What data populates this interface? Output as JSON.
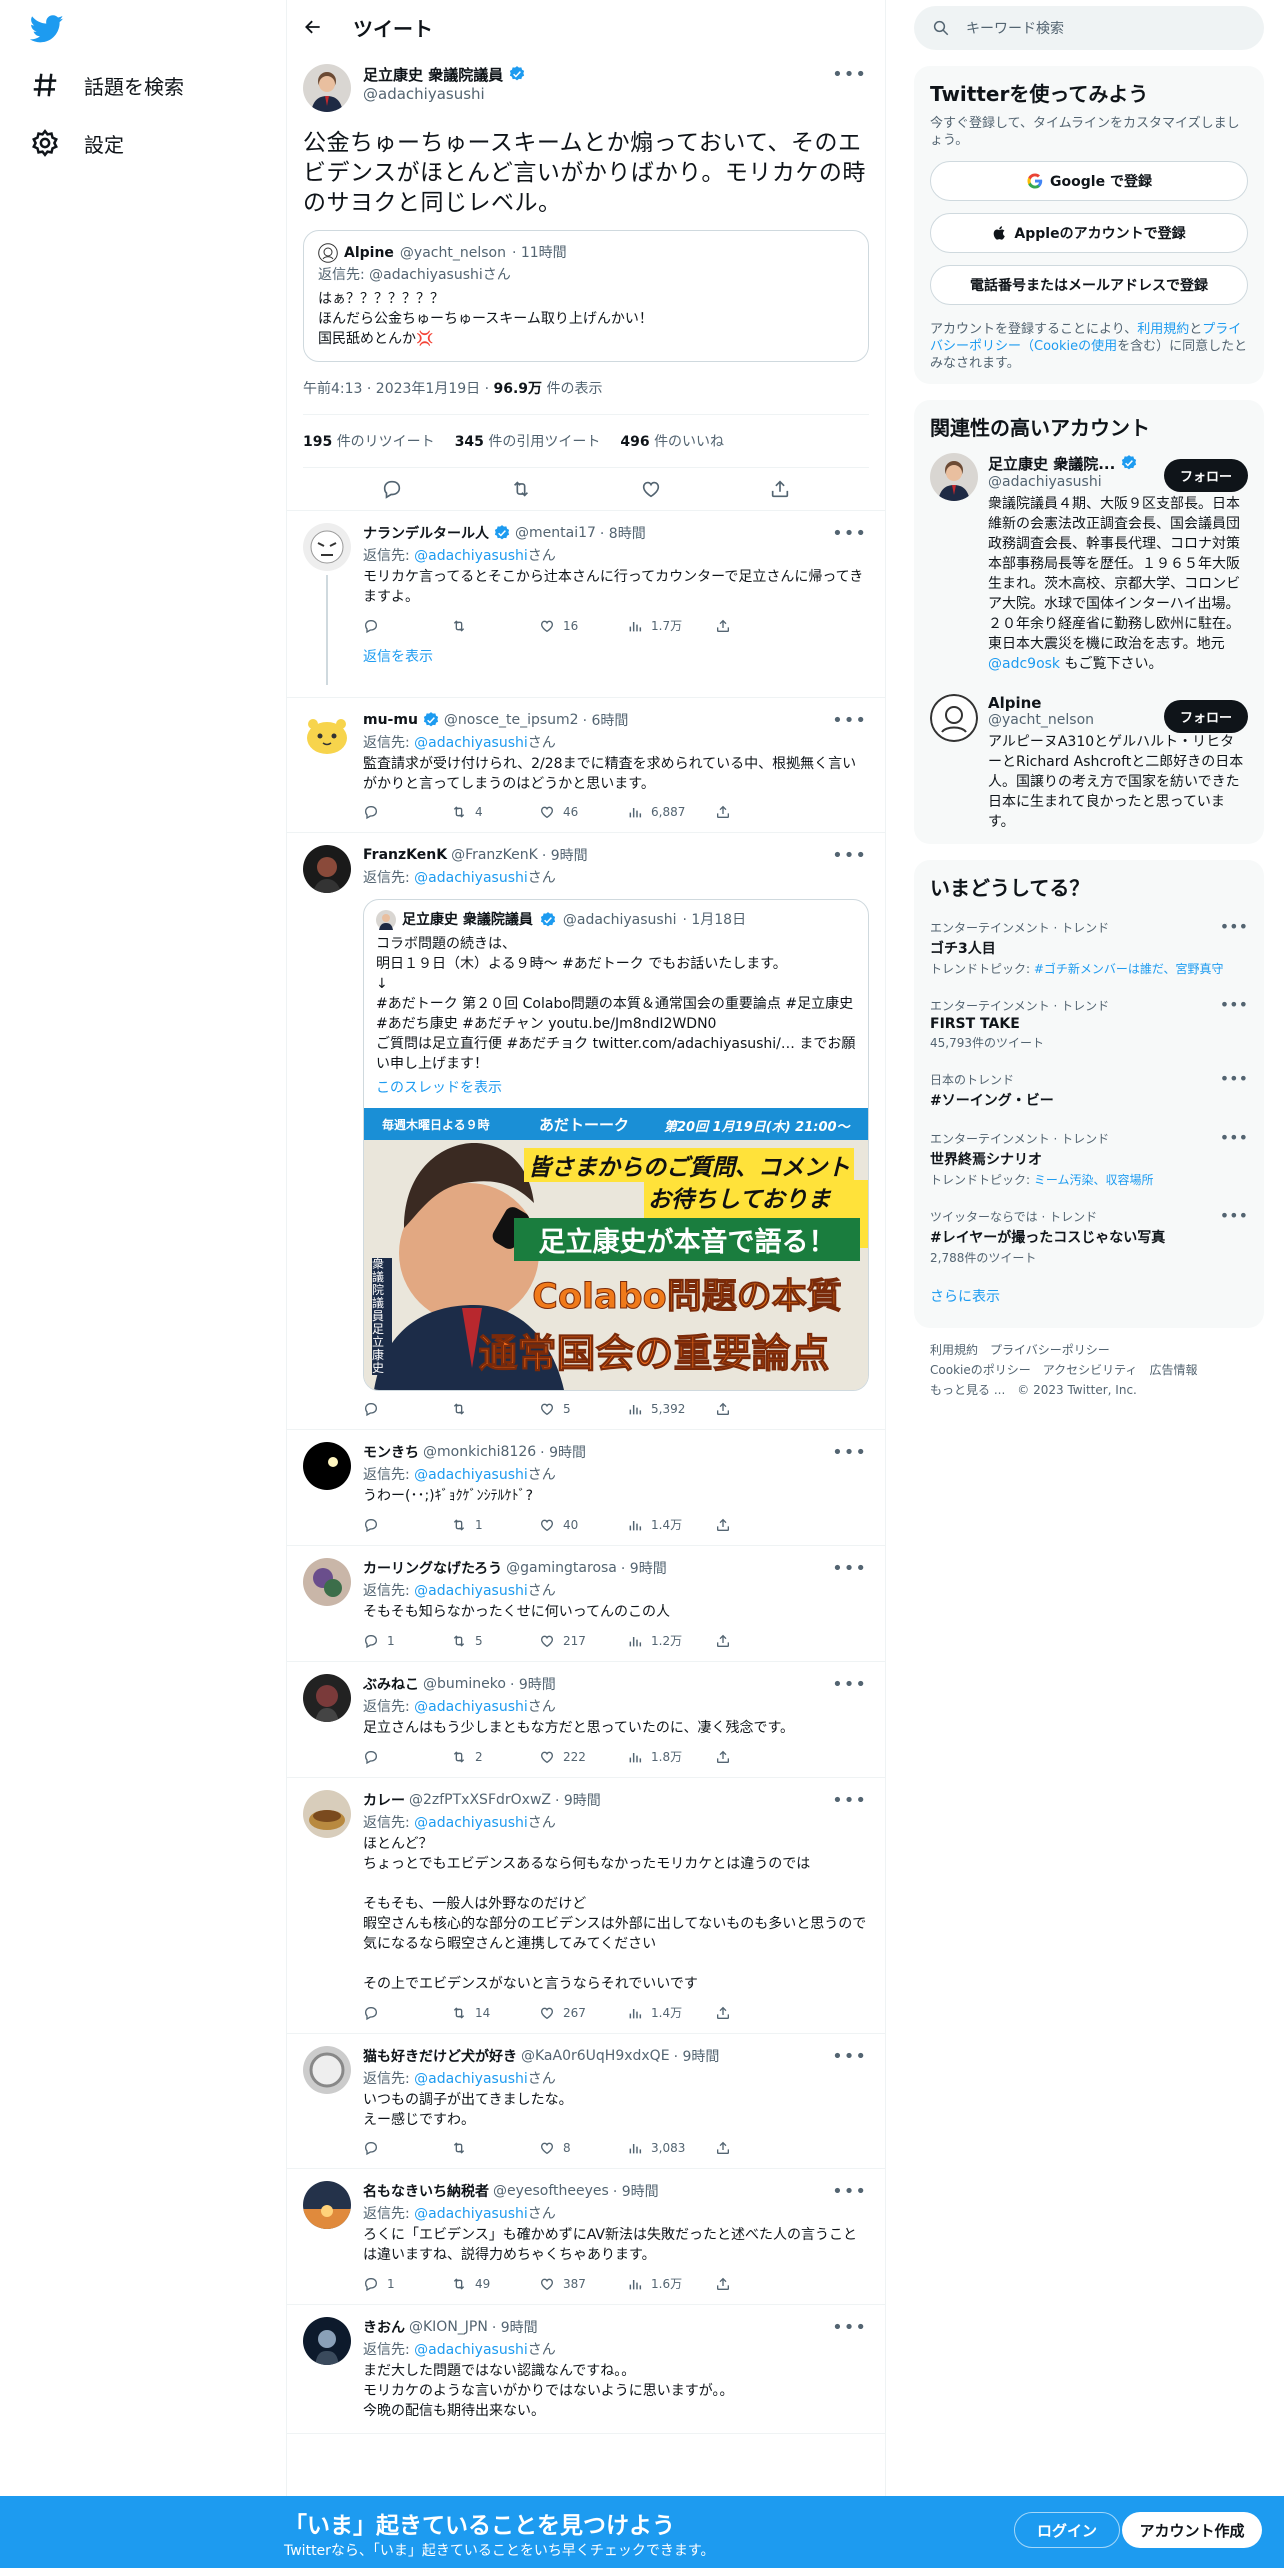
{
  "colors": {
    "accent": "#1d9bf0",
    "text": "#0f1419",
    "muted": "#536471"
  },
  "nav": {
    "explore": "話題を検索",
    "settings": "設定"
  },
  "header": {
    "title": "ツイート"
  },
  "tweet": {
    "name": "足立康史 衆議院議員",
    "handle": "@adachiyasushi",
    "text": "公金ちゅーちゅースキームとか煽っておいて、そのエビデンスがほとんど言いがかりばかり。モリカケの時のサヨクと同じレベル。",
    "quote": {
      "name": "Alpine",
      "handle": "@yacht_nelson",
      "time": "· 11時間",
      "replyto": "返信先: @adachiyasushiさん",
      "text": "はぁ？？？？？？？\nほんだら公金ちゅーちゅースキーム取り上げんかい！\n国民舐めとんか💢"
    },
    "time": "午前4:13 · 2023年1月19日 · ",
    "views_num": "96.9万",
    "views_label": " 件の表示",
    "retweets": "195",
    "retweets_label": "件のリツイート",
    "quotes": "345",
    "quotes_label": "件の引用ツイート",
    "likes": "496",
    "likes_label": "件のいいね"
  },
  "replies": [
    {
      "name": "ナランデルタール人",
      "handle": "@mentai17",
      "time": "· 8時間",
      "replyto_prefix": "返信先: ",
      "replyto_link": "@adachiyasushi",
      "replyto_suffix": "さん",
      "text": "モリカケ言ってるとそこから辻本さんに行ってカウンターで足立さんに帰ってきますよ。",
      "rt": "",
      "likes": "16",
      "views": "1.7万",
      "showmore": "返信を表示"
    },
    {
      "name": "mu-mu",
      "handle": "@nosce_te_ipsum2",
      "time": "· 6時間",
      "replyto_prefix": "返信先: ",
      "replyto_link": "@adachiyasushi",
      "replyto_suffix": "さん",
      "text": "監査請求が受け付けられ、2/28までに精査を求められている中、根拠無く言いがかりと言ってしまうのはどうかと思います。",
      "rt": "4",
      "likes": "46",
      "views": "6,887"
    },
    {
      "name": "FranzKenK",
      "handle": "@FranzKenK",
      "time": "· 9時間",
      "replyto_prefix": "返信先: ",
      "replyto_link": "@adachiyasushi",
      "replyto_suffix": "さん",
      "text": "",
      "rt": "",
      "likes": "5",
      "views": "5,392",
      "embed": {
        "name": "足立康史 衆議院議員",
        "handle": "@adachiyasushi",
        "time": "· 1月18日",
        "text": "コラボ問題の続きは、\n明日１９日（木）よる９時〜 #あだトーク でもお話いたします。\n↓\n#あだトーク 第２０回 Colabo問題の本質＆通常国会の重要論点 #足立康史 #あだち康史 #あだチャン youtu.be/Jm8ndI2WDN0\nご質問は足立直行便 #あだチョク twitter.com/adachiyasushi/… までお願い申し上げます！",
        "thread": "このスレッドを表示",
        "banner": {
          "tag": "毎週木曜日よる９時",
          "show": "あだトーーク",
          "ep": "第20回 1月19日(木) 21:00〜",
          "l1": "皆さまからのご質問、コメント",
          "l2": "お待ちしております！",
          "l3": "足立康史が本音で語る！",
          "l4": "Colabo問題の本質",
          "l5": "通常国会の重要論点",
          "vert": "衆議院議員 足立康史"
        }
      }
    },
    {
      "name": "モンきち",
      "handle": "@monkichi8126",
      "time": "· 9時間",
      "replyto_prefix": "返信先: ",
      "replyto_link": "@adachiyasushi",
      "replyto_suffix": "さん",
      "text": "うわー(･･;)ｷﾞｮｸｹﾞﾝｼﾃﾙｹﾄﾞ?",
      "rt": "1",
      "likes": "40",
      "views": "1.4万"
    },
    {
      "name": "カーリングなげたろう",
      "handle": "@gamingtarosa",
      "time": "· 9時間",
      "replyto_prefix": "返信先: ",
      "replyto_link": "@adachiyasushi",
      "replyto_suffix": "さん",
      "text": "そもそも知らなかったくせに何いってんのこの人",
      "reply": "1",
      "rt": "5",
      "likes": "217",
      "views": "1.2万"
    },
    {
      "name": "ぶみねこ",
      "handle": "@bumineko",
      "time": "· 9時間",
      "replyto_prefix": "返信先: ",
      "replyto_link": "@adachiyasushi",
      "replyto_suffix": "さん",
      "text": "足立さんはもう少しまともな方だと思っていたのに、凄く残念です。",
      "rt": "2",
      "likes": "222",
      "views": "1.8万"
    },
    {
      "name": "カレー",
      "handle": "@2zfPTxXSFdrOxwZ",
      "time": "· 9時間",
      "replyto_prefix": "返信先: ",
      "replyto_link": "@adachiyasushi",
      "replyto_suffix": "さん",
      "text": "ほとんど？\nちょっとでもエビデンスあるなら何もなかったモリカケとは違うのでは\n\nそもそも、一般人は外野なのだけど\n暇空さんも核心的な部分のエビデンスは外部に出してないものも多いと思うので\n気になるなら暇空さんと連携してみてください\n\nその上でエビデンスがないと言うならそれでいいです",
      "rt": "14",
      "likes": "267",
      "views": "1.4万"
    },
    {
      "name": "猫も好きだけど犬が好き",
      "handle": "@KaA0r6UqH9xdxQE",
      "time": "· 9時間",
      "replyto_prefix": "返信先: ",
      "replyto_link": "@adachiyasushi",
      "replyto_suffix": "さん",
      "text": "いつもの調子が出てきましたな。\nえー感じですわ。",
      "rt": "",
      "likes": "8",
      "views": "3,083"
    },
    {
      "name": "名もなきいち納税者",
      "handle": "@eyesoftheeyes",
      "time": "· 9時間",
      "replyto_prefix": "返信先: ",
      "replyto_link": "@adachiyasushi",
      "replyto_suffix": "さん",
      "text": "ろくに「エビデンス」も確かめずにAV新法は失敗だったと述べた人の言うことは違いますね、説得力めちゃくちゃあります。",
      "reply": "1",
      "rt": "49",
      "likes": "387",
      "views": "1.6万"
    },
    {
      "name": "きおん",
      "handle": "@KION_JPN",
      "time": "· 9時間",
      "replyto_prefix": "返信先: ",
      "replyto_link": "@adachiyasushi",
      "replyto_suffix": "さん",
      "text": "まだ大した問題ではない認識なんですね。。\nモリカケのような言いがかりではないように思いますが。。\n今晩の配信も期待出来ない。"
    }
  ],
  "right": {
    "search_placeholder": "キーワード検索",
    "signup": {
      "title": "Twitterを使ってみよう",
      "sub": "今すぐ登録して、タイムラインをカスタマイズしましょう。",
      "google": "Google で登録",
      "apple": "Appleのアカウントで登録",
      "phone": "電話番号またはメールアドレスで登録",
      "legal_pre": "アカウントを登録することにより、",
      "legal_terms": "利用規約",
      "legal_mid": "と",
      "legal_privacy": "プライバシーポリシー（Cookieの使用",
      "legal_post": "を含む）に同意したとみなされます。"
    },
    "related": {
      "title": "関連性の高いアカウント",
      "accounts": [
        {
          "name": "足立康史 衆議院...",
          "handle": "@adachiyasushi",
          "follow": "フォロー",
          "bio": "衆議院議員４期、大阪９区支部長。日本維新の会憲法改正調査会長、国会議員団政務調査会長、幹事長代理、コロナ対策本部事務局長等を歴任。１９６５年大阪生まれ。茨木高校、京都大学、コロンビア大院。水球で国体インターハイ出場。２０年余り経産省に勤務し欧州に駐在。東日本大震災を機に政治を志す。地元 ",
          "bio_link": "@adc9osk",
          "bio_post": " もご覧下さい。"
        },
        {
          "name": "Alpine",
          "handle": "@yacht_nelson",
          "follow": "フォロー",
          "bio": "アルピーヌA310とゲルハルト・リヒターとRichard Ashcroftと二郎好きの日本人。国譲りの考え方で国家を紡いできた日本に生まれて良かったと思っています。"
        }
      ]
    },
    "trends": {
      "title": "いまどうしてる？",
      "items": [
        {
          "ctx": "エンターテインメント · トレンド",
          "title": "ゴチ3人目",
          "sub_pre": "トレンドトピック: ",
          "sub_link": "#ゴチ新メンバーは誰だ、宮野真守"
        },
        {
          "ctx": "エンターテインメント · トレンド",
          "title": "FIRST TAKE",
          "sub_pre": "45,793件のツイート",
          "sub_link": ""
        },
        {
          "ctx": "日本のトレンド",
          "title": "#ソーイング・ビー",
          "sub_pre": "",
          "sub_link": ""
        },
        {
          "ctx": "エンターテインメント · トレンド",
          "title": "世界終焉シナリオ",
          "sub_pre": "トレンドトピック: ",
          "sub_link": "ミーム汚染、収容場所"
        },
        {
          "ctx": "ツイッターならでは · トレンド",
          "title": "#レイヤーが撮ったコスじゃない写真",
          "sub_pre": "2,788件のツイート",
          "sub_link": ""
        }
      ],
      "more": "さらに表示"
    },
    "footer": {
      "l1": "利用規約",
      "l2": "プライバシーポリシー",
      "l3": "Cookieのポリシー",
      "l4": "アクセシビリティ",
      "l5": "広告情報",
      "l6": "もっと見る ...",
      "l7": "© 2023 Twitter, Inc."
    }
  },
  "bottom": {
    "title": "「いま」起きていることを見つけよう",
    "sub": "Twitterなら、「いま」起きていることをいち早くチェックできます。",
    "login": "ログイン",
    "signup": "アカウント作成"
  }
}
